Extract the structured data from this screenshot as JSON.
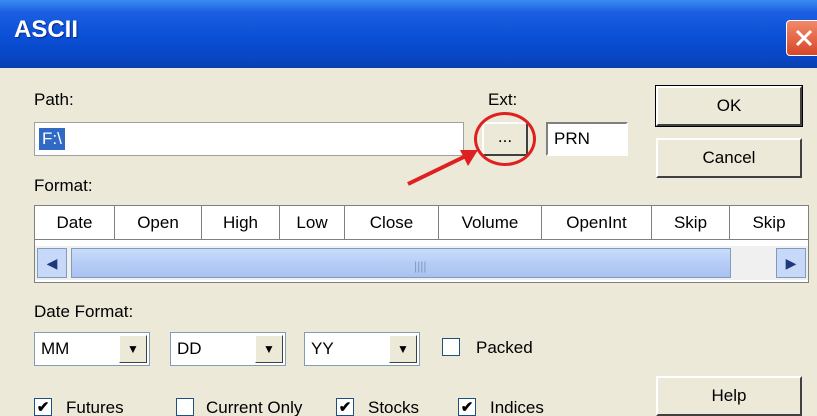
{
  "window": {
    "title": "ASCII"
  },
  "path": {
    "label": "Path:",
    "value": "F:\\",
    "browse_label": "..."
  },
  "ext": {
    "label": "Ext:",
    "value": "PRN"
  },
  "buttons": {
    "ok": "OK",
    "cancel": "Cancel",
    "help": "Help"
  },
  "format": {
    "label": "Format:",
    "columns": [
      "Date",
      "Open",
      "High",
      "Low",
      "Close",
      "Volume",
      "OpenInt",
      "Skip",
      "Skip"
    ]
  },
  "date_format": {
    "label": "Date Format:",
    "month": "MM",
    "day": "DD",
    "year": "YY",
    "packed_label": "Packed",
    "packed_checked": false
  },
  "options": [
    {
      "label": "Futures",
      "checked": true
    },
    {
      "label": "Current Only",
      "checked": false
    },
    {
      "label": "Stocks",
      "checked": true
    },
    {
      "label": "Indices",
      "checked": true
    }
  ],
  "icons": {
    "close": "close-icon",
    "scroll_left": "chevron-left-icon",
    "scroll_right": "chevron-right-icon",
    "dropdown": "chevron-down-icon",
    "annotation": "red-arrow-icon"
  },
  "colors": {
    "title_bar": "#0a4fd6",
    "annotation": "#e02020",
    "selection": "#316ac5"
  }
}
